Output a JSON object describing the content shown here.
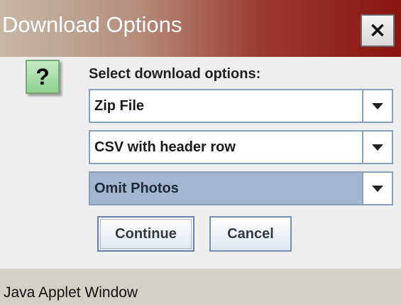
{
  "window": {
    "title": "Download Options",
    "close_label": "×"
  },
  "dialog": {
    "icon_label": "?",
    "prompt": "Select download options:",
    "dropdowns": [
      {
        "value": "Zip File"
      },
      {
        "value": "CSV with header row"
      },
      {
        "value": "Omit Photos"
      }
    ],
    "buttons": {
      "continue": "Continue",
      "cancel": "Cancel"
    }
  },
  "footer": {
    "text": "Java Applet Window"
  },
  "colors": {
    "title_gradient_end": "#8a1410",
    "selected_combo": "#a3b6d0",
    "icon_green": "#8fd08f"
  }
}
